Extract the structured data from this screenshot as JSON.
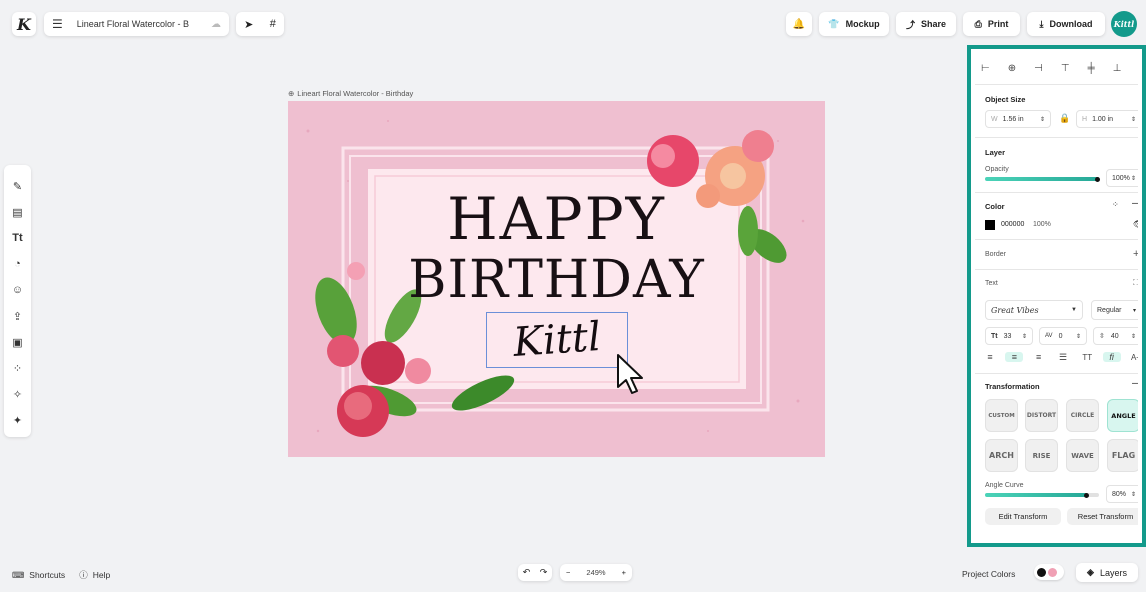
{
  "app": {
    "logo": "K"
  },
  "doc": {
    "title": "Lineart Floral Watercolor - B",
    "canvas_label": "Lineart Floral Watercolor - Birthday"
  },
  "topbar": {
    "mockup": "Mockup",
    "share": "Share",
    "print": "Print",
    "download": "Download",
    "avatar": "Kittl"
  },
  "artboard": {
    "line1": "HAPPY",
    "line2": "BIRTHDAY",
    "script": "Kittl"
  },
  "panel": {
    "object_size": {
      "title": "Object Size",
      "w_label": "W",
      "w_value": "1.56 in",
      "h_label": "H",
      "h_value": "1.00 in"
    },
    "layer": {
      "title": "Layer",
      "opacity_label": "Opacity",
      "opacity_value": "100%",
      "opacity_level": 1.0
    },
    "color": {
      "title": "Color",
      "hex": "000000",
      "alpha": "100%",
      "swatch": "#000000"
    },
    "border": {
      "title": "Border"
    },
    "text": {
      "title": "Text",
      "font": "Great Vibes",
      "weight": "Regular",
      "size": "33",
      "letter_spacing": "0",
      "line_height": "40",
      "caps_label": "TT"
    },
    "transformation": {
      "title": "Transformation",
      "options": [
        "CUSTOM",
        "DISTORT",
        "CIRCLE",
        "ANGLE",
        "ARCH",
        "RISE",
        "WAVE",
        "FLAG"
      ],
      "active": "ANGLE",
      "curve_label": "Angle Curve",
      "curve_value": "80%",
      "curve_level": 0.8,
      "edit_button": "Edit Transform",
      "reset_button": "Reset Transform"
    }
  },
  "bottom": {
    "shortcuts": "Shortcuts",
    "help": "Help",
    "zoom": "249%",
    "project_colors": "Project Colors",
    "layers": "Layers"
  },
  "colors": {
    "accent": "#139a8b",
    "artboard_bg": "#efbfd0",
    "slider": "#2db5a0"
  }
}
